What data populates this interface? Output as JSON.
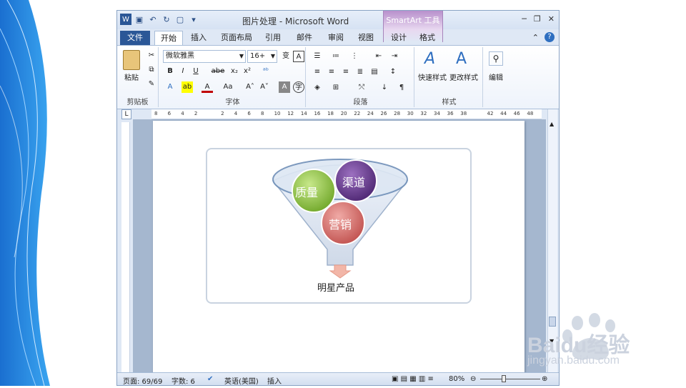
{
  "window": {
    "title": "图片处理 - Microsoft Word",
    "context_tab_group": "SmartArt 工具"
  },
  "tabs": {
    "file": "文件",
    "items": [
      "开始",
      "插入",
      "页面布局",
      "引用",
      "邮件",
      "审阅",
      "视图",
      "设计",
      "格式"
    ],
    "active": "开始"
  },
  "ribbon": {
    "clipboard": {
      "paste": "粘贴",
      "label": "剪贴板"
    },
    "font": {
      "name": "微软雅黑",
      "size": "16+",
      "label": "字体",
      "bold": "B",
      "italic": "I",
      "underline": "U",
      "strike": "abe",
      "sub": "x₂",
      "sup": "x²",
      "grow": "A˄",
      "shrink": "A˅",
      "case": "Aa"
    },
    "paragraph": {
      "label": "段落"
    },
    "styles": {
      "quick": "快速样式",
      "change": "更改样式",
      "label": "样式"
    },
    "editing": {
      "label": "编辑"
    }
  },
  "ruler": {
    "ticks": [
      "8",
      "6",
      "4",
      "2",
      "",
      "2",
      "4",
      "6",
      "8",
      "10",
      "12",
      "14",
      "16",
      "18",
      "20",
      "22",
      "24",
      "26",
      "28",
      "30",
      "32",
      "34",
      "36",
      "38",
      "",
      "42",
      "44",
      "46",
      "48"
    ]
  },
  "smartart": {
    "bubbles": [
      "质量",
      "渠道",
      "营销"
    ],
    "result": "明星产品"
  },
  "status": {
    "page": "页面: 69/69",
    "words": "字数: 6",
    "language": "英语(美国)",
    "mode": "插入",
    "zoom": "80%"
  },
  "watermark": {
    "brand": "Baidu经验",
    "url": "jingyan.baidu.com"
  },
  "colors": {
    "file_tab": "#2b5797",
    "context_tab": "#b890cc",
    "green_bubble": "#8cc63f",
    "purple_bubble": "#6a3d8f",
    "red_bubble": "#d9736e"
  }
}
